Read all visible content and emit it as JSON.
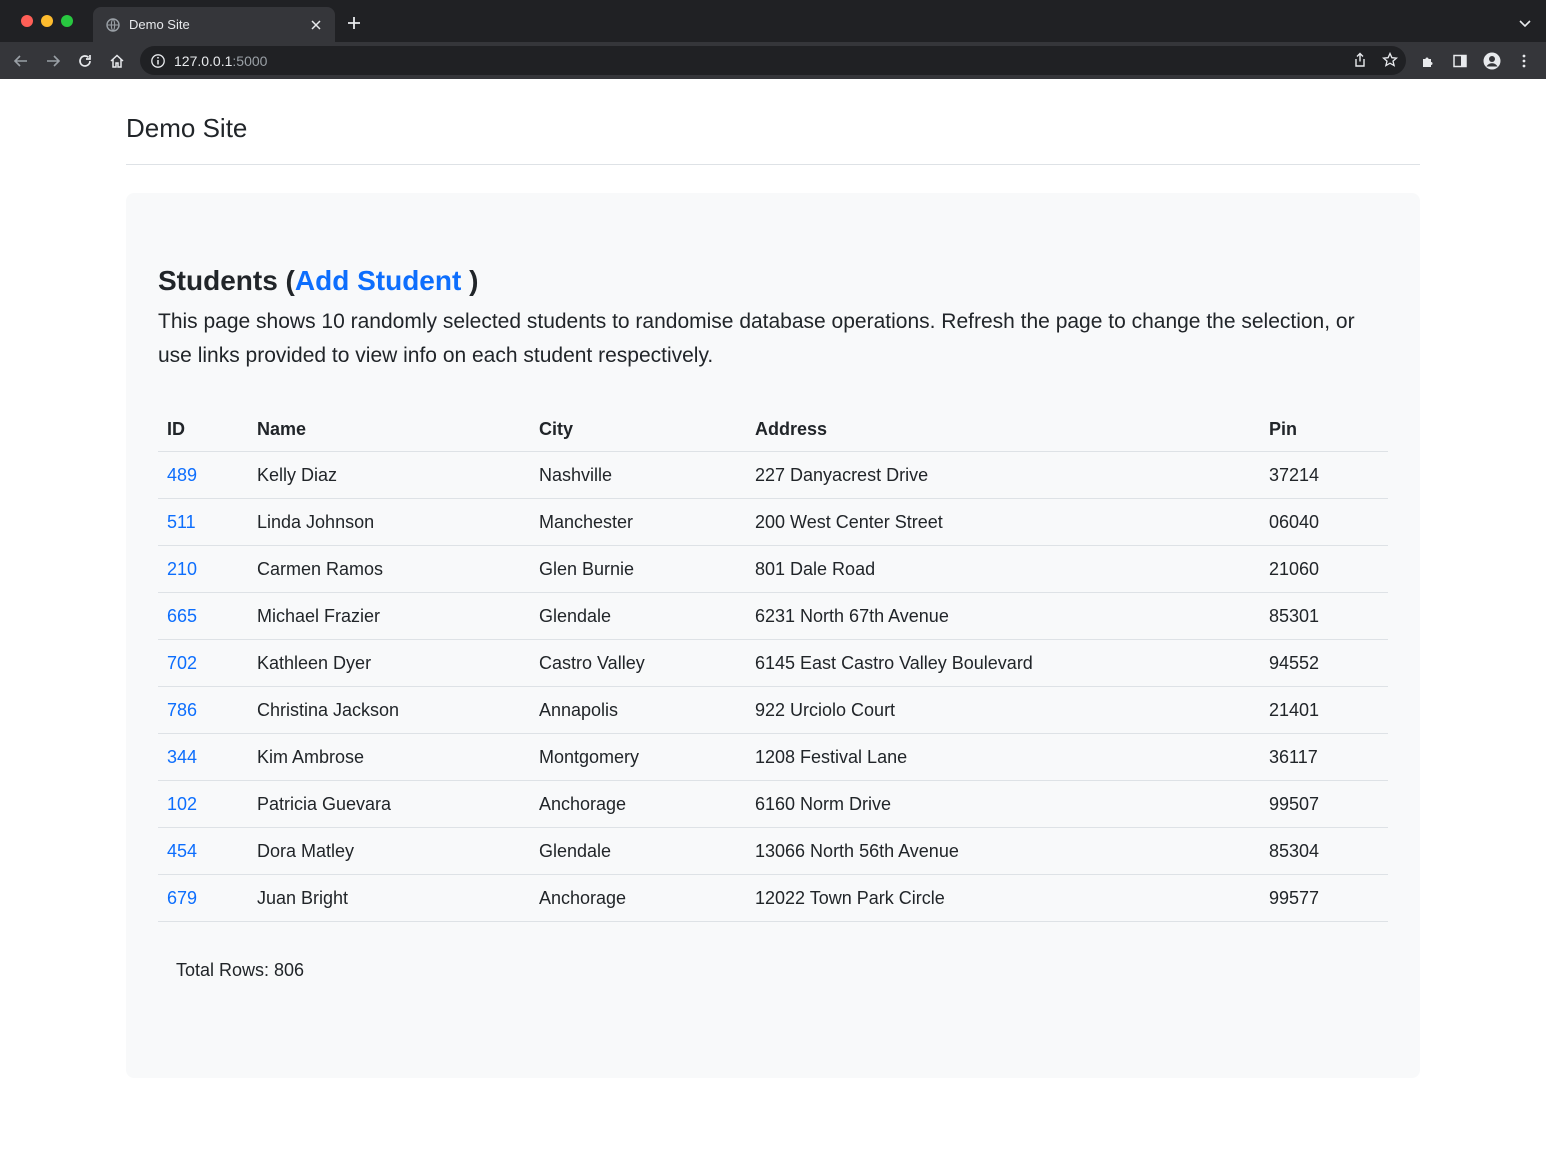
{
  "browser": {
    "tab_title": "Demo Site",
    "url_host": "127.0.0.1",
    "url_port": ":5000"
  },
  "site": {
    "title": "Demo Site"
  },
  "students": {
    "heading_prefix": "Students (",
    "add_link": "Add Student",
    "heading_suffix": " )",
    "description": "This page shows 10 randomly selected students to randomise database operations. Refresh the page to change the selection, or use links provided to view info on each student respectively.",
    "columns": [
      "ID",
      "Name",
      "City",
      "Address",
      "Pin"
    ],
    "rows": [
      {
        "id": "489",
        "name": "Kelly Diaz",
        "city": "Nashville",
        "address": "227 Danyacrest Drive",
        "pin": "37214"
      },
      {
        "id": "511",
        "name": "Linda Johnson",
        "city": "Manchester",
        "address": "200 West Center Street",
        "pin": "06040"
      },
      {
        "id": "210",
        "name": "Carmen Ramos",
        "city": "Glen Burnie",
        "address": "801 Dale Road",
        "pin": "21060"
      },
      {
        "id": "665",
        "name": "Michael Frazier",
        "city": "Glendale",
        "address": "6231 North 67th Avenue",
        "pin": "85301"
      },
      {
        "id": "702",
        "name": "Kathleen Dyer",
        "city": "Castro Valley",
        "address": "6145 East Castro Valley Boulevard",
        "pin": "94552"
      },
      {
        "id": "786",
        "name": "Christina Jackson",
        "city": "Annapolis",
        "address": "922 Urciolo Court",
        "pin": "21401"
      },
      {
        "id": "344",
        "name": "Kim Ambrose",
        "city": "Montgomery",
        "address": "1208 Festival Lane",
        "pin": "36117"
      },
      {
        "id": "102",
        "name": "Patricia Guevara",
        "city": "Anchorage",
        "address": "6160 Norm Drive",
        "pin": "99507"
      },
      {
        "id": "454",
        "name": "Dora Matley",
        "city": "Glendale",
        "address": "13066 North 56th Avenue",
        "pin": "85304"
      },
      {
        "id": "679",
        "name": "Juan Bright",
        "city": "Anchorage",
        "address": "12022 Town Park Circle",
        "pin": "99577"
      }
    ],
    "total_rows": "Total Rows: 806"
  },
  "colors": {
    "link": "#0d6efd",
    "panel_bg": "#f8f9fa",
    "chrome_bg": "#202124"
  }
}
